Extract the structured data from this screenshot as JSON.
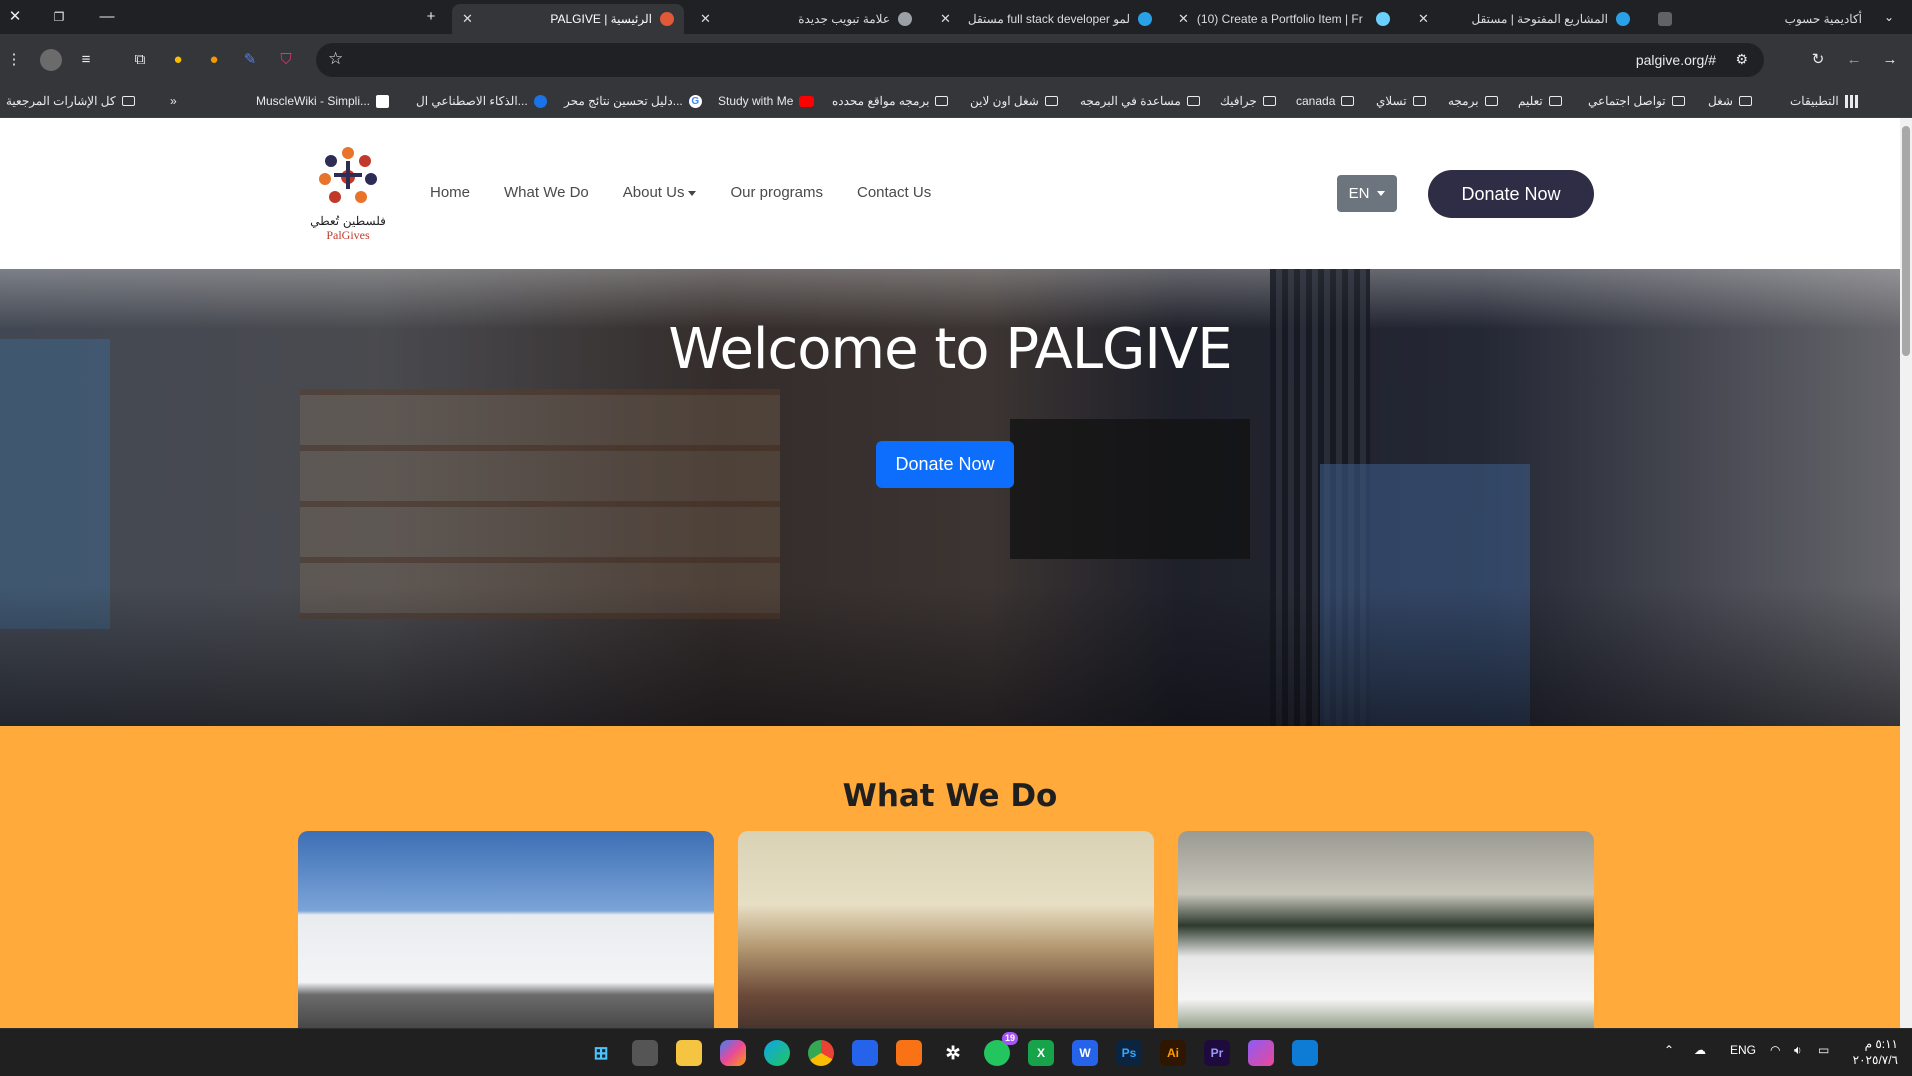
{
  "browser": {
    "tabs": [
      {
        "title": "أكاديمية حسوب",
        "active": false
      },
      {
        "title": "المشاريع المفتوحة | مستقل",
        "active": false
      },
      {
        "title": "(10) Create a Portfolio Item | Fr",
        "active": false
      },
      {
        "title": "مستقل full stack developer لمو",
        "active": false
      },
      {
        "title": "علامة تبويب جديدة",
        "active": false
      },
      {
        "title": "PALGIVE | الرئيسية",
        "active": true
      }
    ],
    "url": "palgive.org/#",
    "bookmarks": [
      {
        "label": "التطبيقات",
        "icon": "apps-icon"
      },
      {
        "label": "شغل",
        "icon": "folder-icon"
      },
      {
        "label": "تواصل اجتماعي",
        "icon": "folder-icon"
      },
      {
        "label": "تعليم",
        "icon": "folder-icon"
      },
      {
        "label": "برمجه",
        "icon": "folder-icon"
      },
      {
        "label": "تسلاي",
        "icon": "folder-icon"
      },
      {
        "label": "canada",
        "icon": "folder-icon"
      },
      {
        "label": "جرافيك",
        "icon": "folder-icon"
      },
      {
        "label": "مساعدة في البرمجه",
        "icon": "folder-icon"
      },
      {
        "label": "شغل اون لاين",
        "icon": "folder-icon"
      },
      {
        "label": "برمجه مواقع محدده",
        "icon": "folder-icon"
      },
      {
        "label": "Study with Me",
        "icon": "youtube-icon"
      },
      {
        "label": "دليل تحسين نتائج محر...",
        "icon": "google-icon"
      },
      {
        "label": "الذكاء الاصطناعي ال...",
        "icon": "site-icon"
      },
      {
        "label": "MuscleWiki - Simpli...",
        "icon": "site-icon"
      }
    ],
    "all_bookmarks": "كل الإشارات المرجعية"
  },
  "site": {
    "logo": {
      "arabic": "فلسطين تُعطي",
      "english": "PalGives"
    },
    "nav": {
      "home": "Home",
      "what_we_do": "What We Do",
      "about_us": "About Us",
      "programs": "Our programs",
      "contact": "Contact Us"
    },
    "lang": "EN",
    "donate_nav": "Donate Now",
    "hero": {
      "title": "Welcome to PALGIVE",
      "button": "Donate Now"
    },
    "what_we_do": {
      "title": "What We Do"
    }
  },
  "taskbar": {
    "lang": "ENG",
    "time": "٥:١١ م",
    "date": "٢٠٢٥/٧/٦",
    "whatsapp_badge": "19",
    "apps": [
      "start",
      "task-view",
      "file-explorer",
      "copilot",
      "edge",
      "chrome",
      "store",
      "xampp",
      "chatgpt",
      "whatsapp",
      "excel",
      "word",
      "photoshop",
      "illustrator",
      "premiere",
      "instagram",
      "vscode"
    ]
  },
  "colors": {
    "donate_nav_bg": "#2f2c45",
    "hero_btn_bg": "#0d6efd",
    "wwd_bg": "#ffaa3b",
    "lang_bg": "#6c757d"
  }
}
